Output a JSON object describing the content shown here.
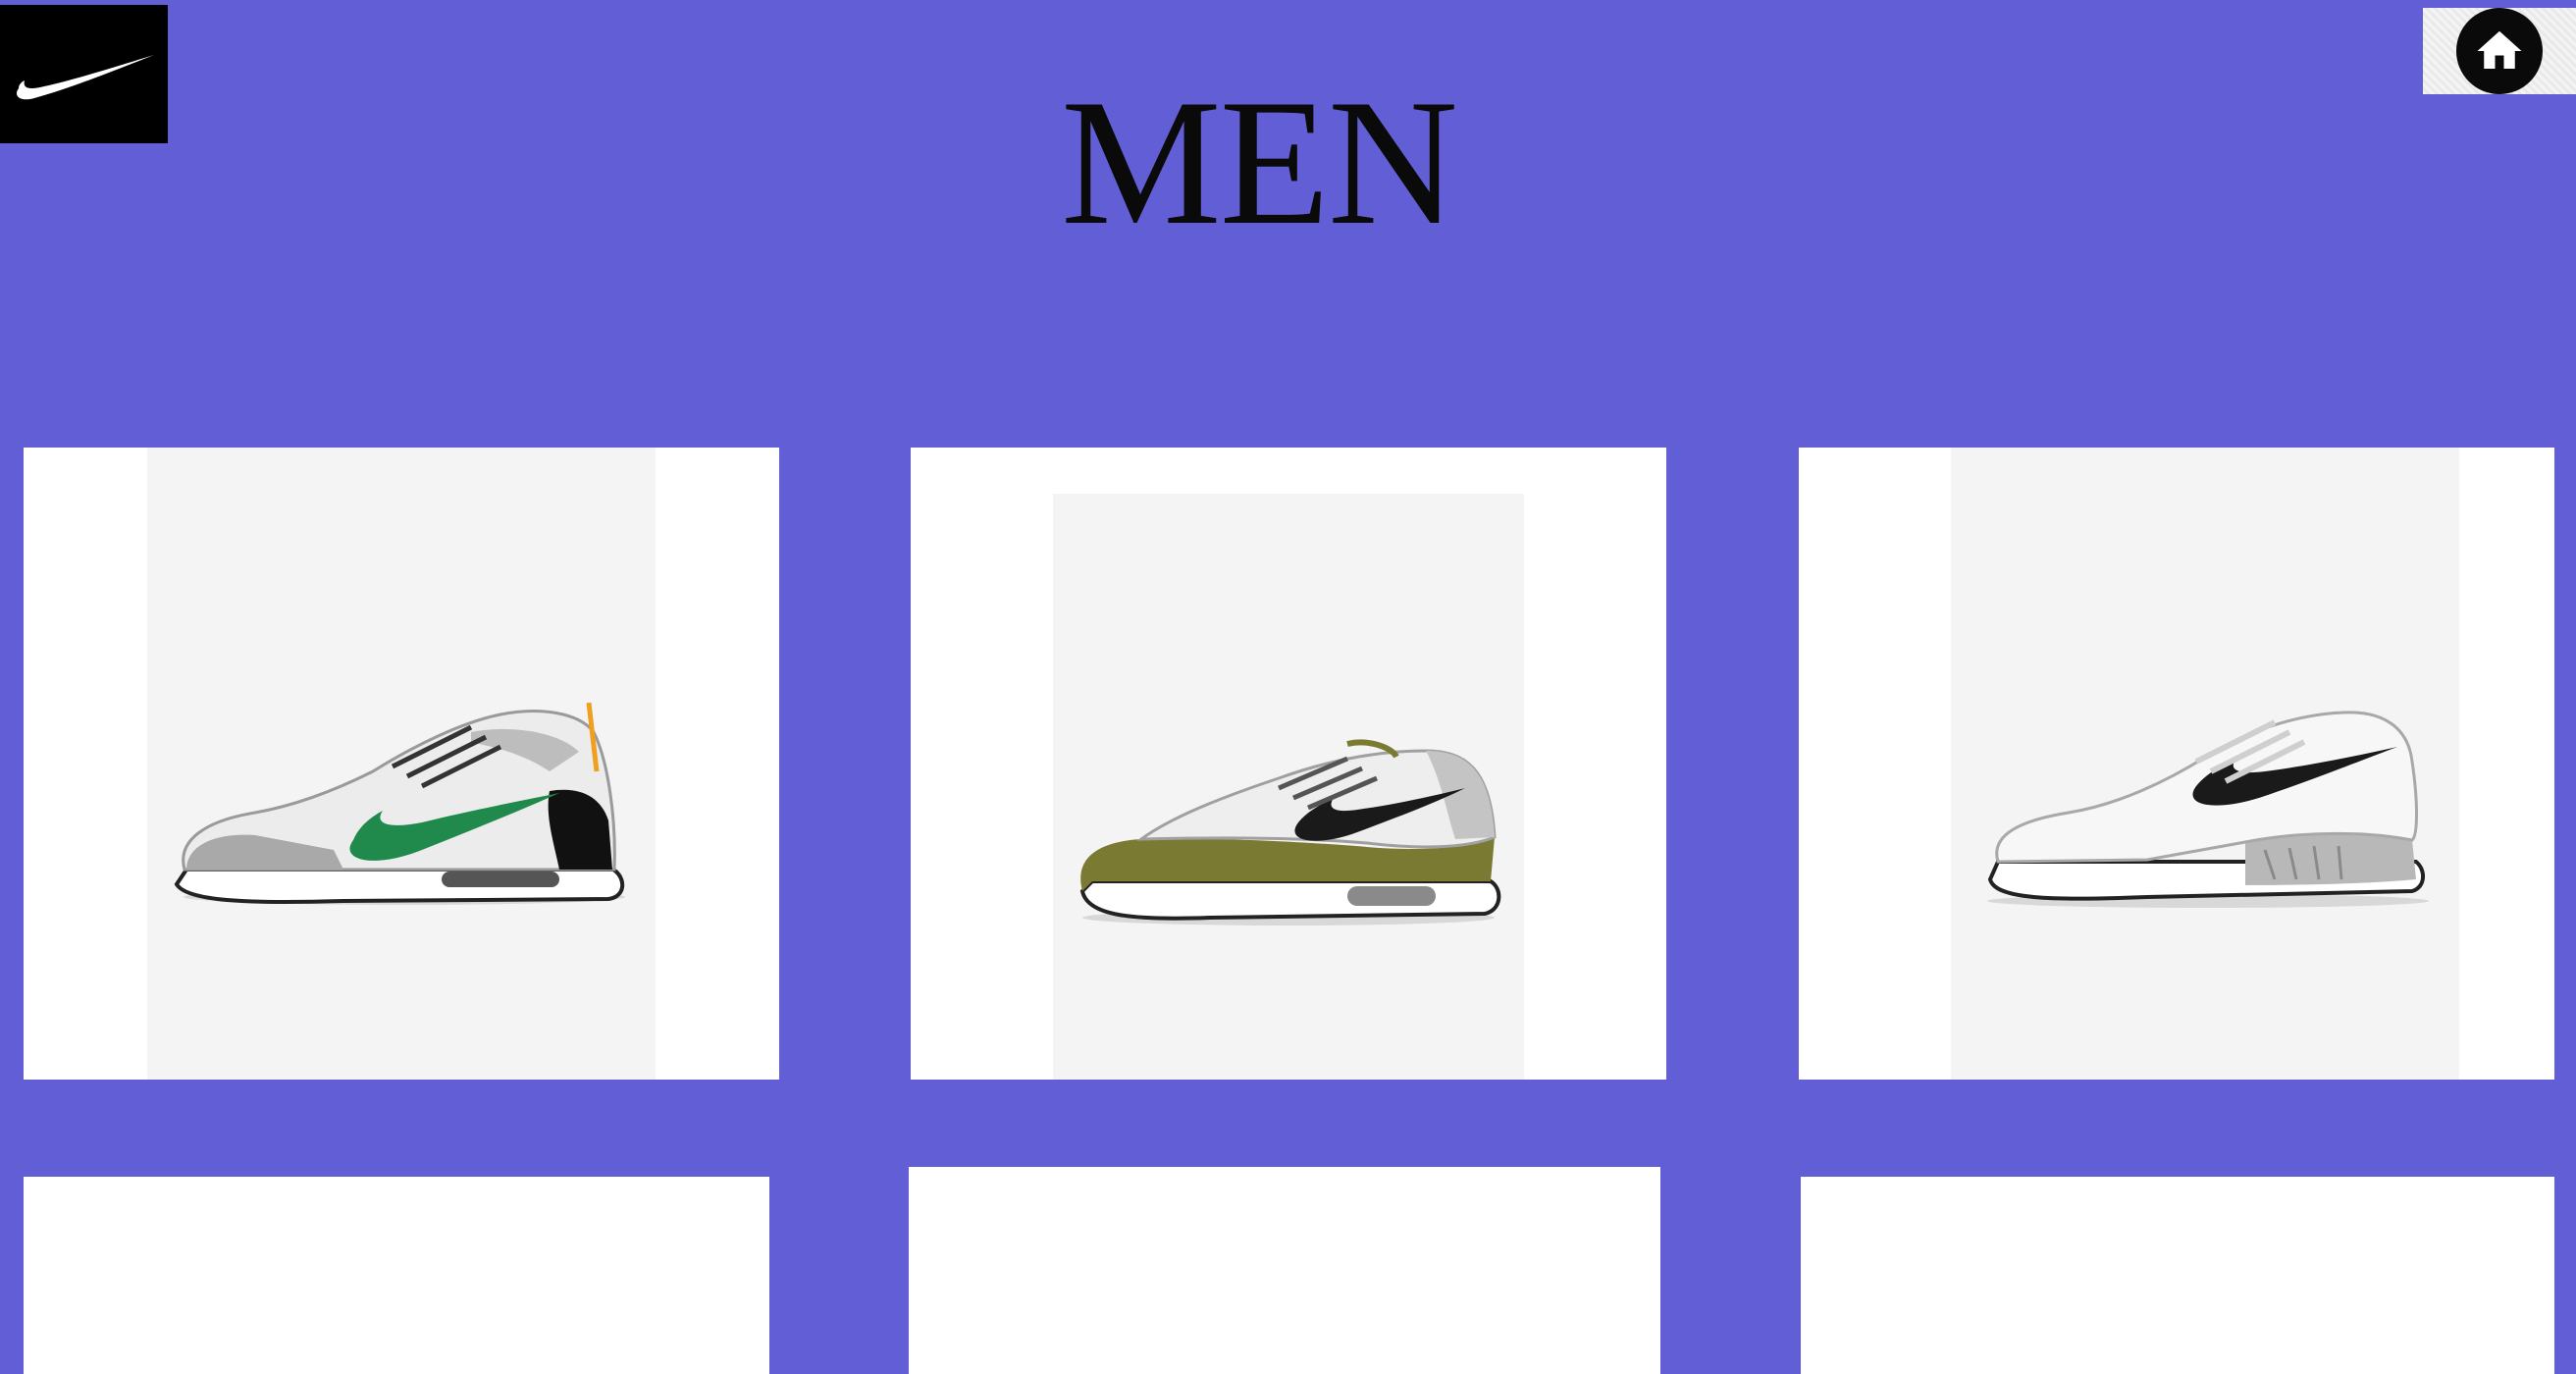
{
  "header": {
    "title": "MEN",
    "logo_icon": "nike-swoosh-icon",
    "home_icon": "home-icon"
  },
  "colors": {
    "background": "#625fd6",
    "card": "#ffffff",
    "image_bg": "#f4f4f4",
    "logo_bg": "#000000"
  },
  "products": [
    {
      "id": 1,
      "image": "shoe-white-grey-green-swoosh",
      "accent": "#1f8a4c"
    },
    {
      "id": 2,
      "image": "shoe-white-olive-black-swoosh",
      "accent": "#7a7a32"
    },
    {
      "id": 3,
      "image": "shoe-all-white-black-swoosh",
      "accent": "#1a1a1a"
    },
    {
      "id": 4
    },
    {
      "id": 5
    },
    {
      "id": 6
    }
  ]
}
